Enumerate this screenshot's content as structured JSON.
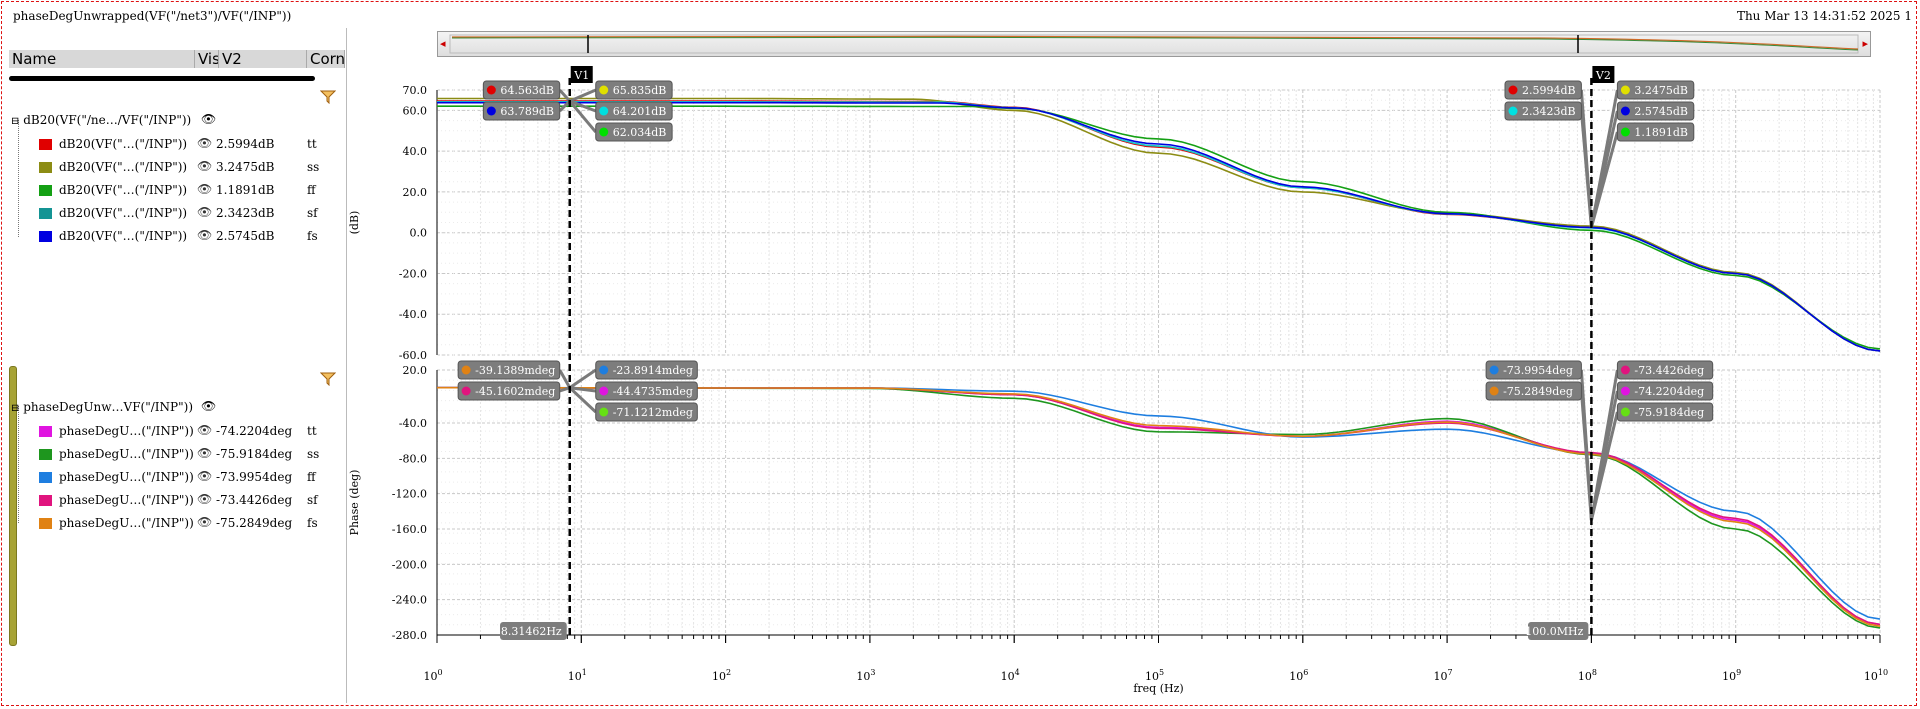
{
  "window": {
    "title": "phaseDegUnwrapped(VF(\"/net3\")/VF(\"/INP\"))",
    "timestamp": "Thu Mar 13 14:31:52 2025  1"
  },
  "browser": {
    "columns": [
      "Name",
      "Vis",
      "V2",
      "Corne"
    ],
    "groups": [
      {
        "label": "dB20(VF(\"/ne…/VF(\"/INP\"))",
        "rows": [
          {
            "name": "dB20(VF(\"…(\"/INP\"))",
            "value": "2.5994dB",
            "corner": "tt",
            "color": "#e00000"
          },
          {
            "name": "dB20(VF(\"…(\"/INP\"))",
            "value": "3.2475dB",
            "corner": "ss",
            "color": "#8c8c14"
          },
          {
            "name": "dB20(VF(\"…(\"/INP\"))",
            "value": "1.1891dB",
            "corner": "ff",
            "color": "#14a014"
          },
          {
            "name": "dB20(VF(\"…(\"/INP\"))",
            "value": "2.3423dB",
            "corner": "sf",
            "color": "#149494"
          },
          {
            "name": "dB20(VF(\"…(\"/INP\"))",
            "value": "2.5745dB",
            "corner": "fs",
            "color": "#0000e0"
          }
        ]
      },
      {
        "label": "phaseDegUnw…VF(\"/INP\"))",
        "rows": [
          {
            "name": "phaseDegU…(\"/INP\"))",
            "value": "-74.2204deg",
            "corner": "tt",
            "color": "#e014e0"
          },
          {
            "name": "phaseDegU…(\"/INP\"))",
            "value": "-75.9184deg",
            "corner": "ss",
            "color": "#1e961e"
          },
          {
            "name": "phaseDegU…(\"/INP\"))",
            "value": "-73.9954deg",
            "corner": "ff",
            "color": "#1e7ee0"
          },
          {
            "name": "phaseDegU…(\"/INP\"))",
            "value": "-73.4426deg",
            "corner": "sf",
            "color": "#e0147e"
          },
          {
            "name": "phaseDegU…(\"/INP\"))",
            "value": "-75.2849deg",
            "corner": "fs",
            "color": "#e08214"
          }
        ]
      }
    ]
  },
  "chart_data": {
    "type": "line",
    "xlabel": "freq (Hz)",
    "x_scale": "log",
    "xlim": [
      1,
      10000000000
    ],
    "x_tick_labels": [
      "10^0",
      "10^1",
      "10^2",
      "10^3",
      "10^4",
      "10^5",
      "10^6",
      "10^7",
      "10^8",
      "10^9",
      "10^10"
    ],
    "cursors": [
      {
        "name": "V1",
        "freq": 8.31462,
        "label": "8.31462Hz"
      },
      {
        "name": "V2",
        "freq": 100000000,
        "label": "100.0MHz"
      }
    ],
    "panels": [
      {
        "ylabel": "(dB)",
        "ylim": [
          -60,
          70
        ],
        "y_ticks": [
          "70.0",
          "60.0",
          "40.0",
          "20.0",
          "0.0",
          "-20.0",
          "-40.0",
          "-60.0"
        ],
        "series": [
          {
            "corner": "tt",
            "color": "#e00000",
            "points": [
              [
                1,
                64.563
              ],
              [
                100,
                64.56
              ],
              [
                3000,
                64.3
              ],
              [
                10000,
                61.5
              ],
              [
                100000,
                42
              ],
              [
                1000000,
                22
              ],
              [
                10000000,
                9
              ],
              [
                100000000,
                2.5994
              ],
              [
                1000000000,
                -20
              ],
              [
                10000000000,
                -58
              ]
            ]
          },
          {
            "corner": "ss",
            "color": "#8c8c14",
            "points": [
              [
                1,
                65.835
              ],
              [
                100,
                65.83
              ],
              [
                2000,
                65.5
              ],
              [
                10000,
                60
              ],
              [
                100000,
                39
              ],
              [
                1000000,
                20
              ],
              [
                10000000,
                9.5
              ],
              [
                100000000,
                3.2475
              ],
              [
                1000000000,
                -19.5
              ],
              [
                10000000000,
                -58
              ]
            ]
          },
          {
            "corner": "ff",
            "color": "#14a014",
            "points": [
              [
                1,
                62.034
              ],
              [
                100,
                62.03
              ],
              [
                5000,
                61.9
              ],
              [
                10000,
                61
              ],
              [
                100000,
                46
              ],
              [
                1000000,
                25
              ],
              [
                10000000,
                10
              ],
              [
                100000000,
                1.1891
              ],
              [
                1000000000,
                -21
              ],
              [
                10000000000,
                -57
              ]
            ]
          },
          {
            "corner": "sf",
            "color": "#14c8c8",
            "points": [
              [
                1,
                64.201
              ],
              [
                100,
                64.2
              ],
              [
                3000,
                64
              ],
              [
                10000,
                61.3
              ],
              [
                100000,
                42.5
              ],
              [
                1000000,
                22
              ],
              [
                10000000,
                9.2
              ],
              [
                100000000,
                2.3423
              ],
              [
                1000000000,
                -20
              ],
              [
                10000000000,
                -58
              ]
            ]
          },
          {
            "corner": "fs",
            "color": "#0000e0",
            "points": [
              [
                1,
                63.789
              ],
              [
                100,
                63.78
              ],
              [
                3000,
                63.6
              ],
              [
                10000,
                61.2
              ],
              [
                100000,
                43.5
              ],
              [
                1000000,
                22.5
              ],
              [
                10000000,
                9.3
              ],
              [
                100000000,
                2.5745
              ],
              [
                1000000000,
                -20
              ],
              [
                10000000000,
                -58
              ]
            ]
          }
        ],
        "markers": [
          {
            "text": "64.563dB",
            "color": "#e00000",
            "side": "left",
            "row": 0,
            "cursor": "V1"
          },
          {
            "text": "63.789dB",
            "color": "#0000e0",
            "side": "left",
            "row": 1,
            "cursor": "V1"
          },
          {
            "text": "65.835dB",
            "color": "#e0e000",
            "side": "right",
            "row": 0,
            "cursor": "V1"
          },
          {
            "text": "64.201dB",
            "color": "#00e0e0",
            "side": "right",
            "row": 1,
            "cursor": "V1"
          },
          {
            "text": "62.034dB",
            "color": "#00e000",
            "side": "right",
            "row": 2,
            "cursor": "V1"
          },
          {
            "text": "2.5994dB",
            "color": "#e00000",
            "side": "left",
            "row": 0,
            "cursor": "V2"
          },
          {
            "text": "2.3423dB",
            "color": "#00e0e0",
            "side": "left",
            "row": 1,
            "cursor": "V2"
          },
          {
            "text": "3.2475dB",
            "color": "#e0e000",
            "side": "right",
            "row": 0,
            "cursor": "V2"
          },
          {
            "text": "2.5745dB",
            "color": "#0000e0",
            "side": "right",
            "row": 1,
            "cursor": "V2"
          },
          {
            "text": "1.1891dB",
            "color": "#00e000",
            "side": "right",
            "row": 2,
            "cursor": "V2"
          }
        ]
      },
      {
        "ylabel": "Phase (deg)",
        "ylim": [
          -280,
          20
        ],
        "y_ticks": [
          "20.0",
          "-40.0",
          "-80.0",
          "-120.0",
          "-160.0",
          "-200.0",
          "-240.0",
          "-280.0"
        ],
        "series": [
          {
            "corner": "tt",
            "color": "#e014e0",
            "points": [
              [
                1,
                -0.044
              ],
              [
                1000,
                -0.5
              ],
              [
                10000,
                -8
              ],
              [
                100000,
                -45
              ],
              [
                1000000,
                -55
              ],
              [
                10000000,
                -38
              ],
              [
                100000000,
                -74.2204
              ],
              [
                1000000000,
                -150
              ],
              [
                10000000000,
                -268
              ]
            ]
          },
          {
            "corner": "ss",
            "color": "#1e961e",
            "points": [
              [
                1,
                -0.071
              ],
              [
                1000,
                -0.8
              ],
              [
                10000,
                -12
              ],
              [
                100000,
                -50
              ],
              [
                1000000,
                -53
              ],
              [
                10000000,
                -35
              ],
              [
                100000000,
                -75.9184
              ],
              [
                1000000000,
                -160
              ],
              [
                10000000000,
                -272
              ]
            ]
          },
          {
            "corner": "ff",
            "color": "#1e7ee0",
            "points": [
              [
                1,
                -0.024
              ],
              [
                1000,
                -0.3
              ],
              [
                10000,
                -4
              ],
              [
                100000,
                -32
              ],
              [
                1000000,
                -56
              ],
              [
                10000000,
                -47
              ],
              [
                100000000,
                -73.9954
              ],
              [
                1000000000,
                -140
              ],
              [
                10000000000,
                -262
              ]
            ]
          },
          {
            "corner": "sf",
            "color": "#e0147e",
            "points": [
              [
                1,
                -0.045
              ],
              [
                1000,
                -0.5
              ],
              [
                10000,
                -8
              ],
              [
                100000,
                -46
              ],
              [
                1000000,
                -55
              ],
              [
                10000000,
                -40
              ],
              [
                100000000,
                -73.4426
              ],
              [
                1000000000,
                -148
              ],
              [
                10000000000,
                -268
              ]
            ]
          },
          {
            "corner": "fs",
            "color": "#e08214",
            "points": [
              [
                1,
                -0.039
              ],
              [
                1000,
                -0.45
              ],
              [
                10000,
                -7
              ],
              [
                100000,
                -43
              ],
              [
                1000000,
                -55
              ],
              [
                10000000,
                -39
              ],
              [
                100000000,
                -75.2849
              ],
              [
                1000000000,
                -152
              ],
              [
                10000000000,
                -270
              ]
            ]
          }
        ],
        "markers": [
          {
            "text": "-39.1389mdeg",
            "color": "#e08214",
            "side": "left",
            "row": 0,
            "cursor": "V1"
          },
          {
            "text": "-45.1602mdeg",
            "color": "#e0147e",
            "side": "left",
            "row": 1,
            "cursor": "V1"
          },
          {
            "text": "-23.8914mdeg",
            "color": "#1e7ee0",
            "side": "right",
            "row": 0,
            "cursor": "V1"
          },
          {
            "text": "-44.4735mdeg",
            "color": "#e014e0",
            "side": "right",
            "row": 1,
            "cursor": "V1"
          },
          {
            "text": "-71.1212mdeg",
            "color": "#66e014",
            "side": "right",
            "row": 2,
            "cursor": "V1"
          },
          {
            "text": "-73.9954deg",
            "color": "#1e7ee0",
            "side": "left",
            "row": 0,
            "cursor": "V2"
          },
          {
            "text": "-75.2849deg",
            "color": "#e08214",
            "side": "left",
            "row": 1,
            "cursor": "V2"
          },
          {
            "text": "-73.4426deg",
            "color": "#e0147e",
            "side": "right",
            "row": 0,
            "cursor": "V2"
          },
          {
            "text": "-74.2204deg",
            "color": "#e014e0",
            "side": "right",
            "row": 1,
            "cursor": "V2"
          },
          {
            "text": "-75.9184deg",
            "color": "#66e014",
            "side": "right",
            "row": 2,
            "cursor": "V2"
          }
        ]
      }
    ]
  }
}
